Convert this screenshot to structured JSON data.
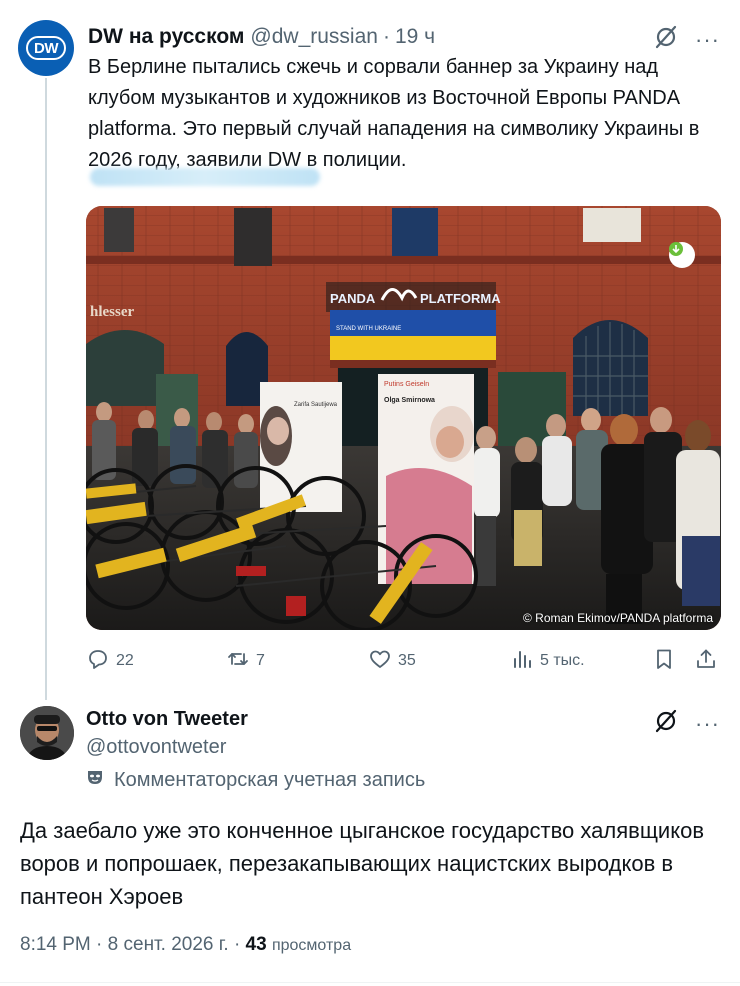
{
  "tweet1": {
    "author_name": "DW на русском",
    "handle": "@dw_russian",
    "separator": "·",
    "time": "19 ч",
    "avatar_text": "DW",
    "text": "В Берлине пытались сжечь и сорвали баннер за Украину над клубом музыкантов и художников из Восточной Европы PANDA platforma. Это первый случай нападения на символику Украины в 2026 году, заявили DW в полиции.",
    "photo": {
      "sign_left": "PANDA",
      "sign_right": "PLATFORMA",
      "banner_text": "STAND WITH UKRAINE",
      "wall_text": "hlesser",
      "poster1_name": "Zarifa Sautijewa",
      "poster2_title": "Putins Geiseln",
      "poster2_name": "Olga Smirnowa",
      "credit": "© Roman Ekimov/PANDA platforma"
    },
    "actions": {
      "replies": "22",
      "reposts": "7",
      "likes": "35",
      "views": "5 тыс."
    }
  },
  "tweet2": {
    "author_name": "Otto von Tweeter",
    "handle": "@ottovontweter",
    "account_label": "Комментаторская учетная запись",
    "text": "Да заебало уже это конченное цыганское государство халявщиков воров и попрошаек, перезакапывающих нацистских выродков в пантеон Хэроев",
    "time": "8:14 PM",
    "date": "8 сент. 2026 г.",
    "separator": "·",
    "views_count": "43",
    "views_word": "просмотра"
  },
  "colors": {
    "text_primary": "#0f1419",
    "text_secondary": "#536471",
    "dw_blue": "#0a5fb4",
    "thread_line": "#cfd9de"
  },
  "icons": {
    "reply": "speech-bubble-icon",
    "repost": "repost-arrows-icon",
    "like": "heart-icon",
    "views": "bar-chart-icon",
    "bookmark": "bookmark-icon",
    "share": "share-upload-icon",
    "grok": "grok-slash-icon",
    "more": "more-dots-icon",
    "commentator": "mask-icon"
  }
}
